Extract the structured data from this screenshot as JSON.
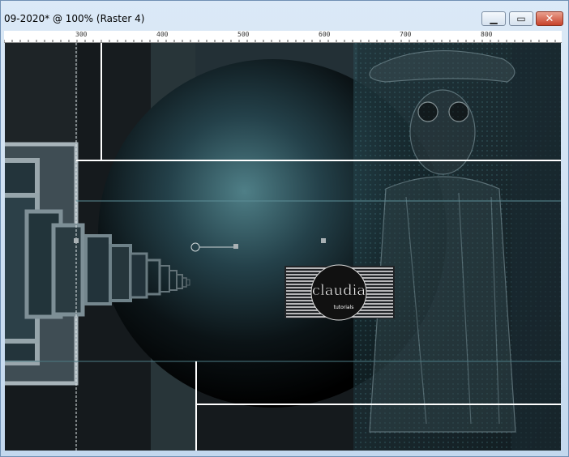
{
  "window": {
    "title": "09-2020* @ 100% (Raster 4)",
    "controls": {
      "minimize_icon": "minimize-icon",
      "maximize_icon": "maximize-icon",
      "close_icon": "close-icon"
    }
  },
  "ruler": {
    "labels": [
      "300",
      "400",
      "500",
      "600",
      "700",
      "800"
    ]
  },
  "canvas": {
    "watermark": {
      "title": "claudia",
      "subtitle": "tutorials"
    },
    "colors": {
      "teal": "#2f5a63",
      "dark": "#0a0c0e",
      "panel": "#9aa8b0",
      "line": "#ffffff"
    }
  }
}
